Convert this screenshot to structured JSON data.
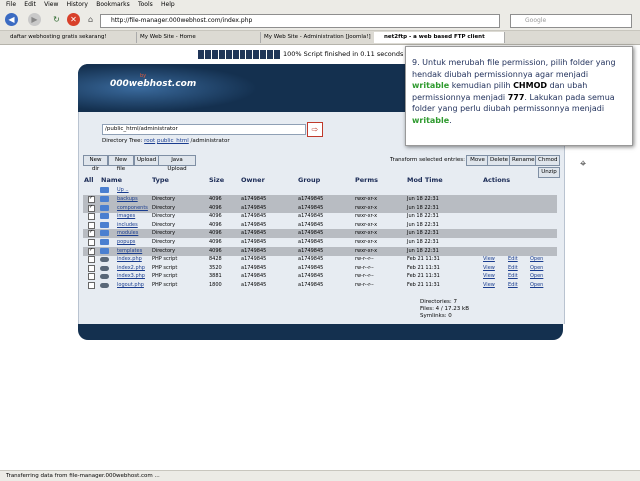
{
  "browser": {
    "menu": [
      "File",
      "Edit",
      "View",
      "History",
      "Bookmarks",
      "Tools",
      "Help"
    ],
    "url": "http://file-manager.000webhost.com/index.php",
    "search_placeholder": "Google",
    "tabs": [
      "daftar webhosting gratis sekarang!",
      "My Web Site - Home",
      "My Web Site - Administration [Joomla!]",
      "net2ftp - a web based FTP client"
    ],
    "status": "Transferring data from file-manager.000webhost.com ..."
  },
  "progress_text": "100% Script finished in 0.11 seconds",
  "logo": {
    "by": "by",
    "name": "000webhost.com"
  },
  "path_input": "/public_html/administrator",
  "tree": {
    "label": "Directory Tree:",
    "root": "root",
    "public_html": "public_html",
    "current": "/administrator"
  },
  "buttons": {
    "new_dir": "New dir",
    "new_file": "New file",
    "upload": "Upload",
    "java_upload": "Java Upload",
    "transform_label": "Transform selected entries:",
    "move": "Move",
    "delete": "Delete",
    "rename": "Rename",
    "chmod": "Chmod",
    "unzip": "Unzip"
  },
  "table": {
    "headers": [
      "All",
      "Name",
      "Type",
      "Size",
      "Owner",
      "Group",
      "Perms",
      "Mod Time",
      "Actions"
    ],
    "up": "Up ..",
    "rows": [
      {
        "name": "backups",
        "type": "Directory",
        "size": "4096",
        "owner": "a1749845",
        "group": "a1749845",
        "perms": "rwxr-xr-x",
        "mod": "Jun 18 22:31",
        "checked": true,
        "gray": true,
        "kind": "dir"
      },
      {
        "name": "components",
        "type": "Directory",
        "size": "4096",
        "owner": "a1749845",
        "group": "a1749845",
        "perms": "rwxr-xr-x",
        "mod": "Jun 18 22:31",
        "checked": true,
        "gray": true,
        "kind": "dir"
      },
      {
        "name": "images",
        "type": "Directory",
        "size": "4096",
        "owner": "a1749845",
        "group": "a1749845",
        "perms": "rwxr-xr-x",
        "mod": "Jun 18 22:31",
        "checked": false,
        "gray": false,
        "kind": "dir"
      },
      {
        "name": "includes",
        "type": "Directory",
        "size": "4096",
        "owner": "a1749845",
        "group": "a1749845",
        "perms": "rwxr-xr-x",
        "mod": "Jun 18 22:31",
        "checked": false,
        "gray": false,
        "kind": "dir"
      },
      {
        "name": "modules",
        "type": "Directory",
        "size": "4096",
        "owner": "a1749845",
        "group": "a1749845",
        "perms": "rwxr-xr-x",
        "mod": "Jun 18 22:31",
        "checked": true,
        "gray": true,
        "kind": "dir"
      },
      {
        "name": "popups",
        "type": "Directory",
        "size": "4096",
        "owner": "a1749845",
        "group": "a1749845",
        "perms": "rwxr-xr-x",
        "mod": "Jun 18 22:31",
        "checked": false,
        "gray": false,
        "kind": "dir"
      },
      {
        "name": "templates",
        "type": "Directory",
        "size": "4096",
        "owner": "a1749845",
        "group": "a1749845",
        "perms": "rwxr-xr-x",
        "mod": "Jun 18 22:31",
        "checked": true,
        "gray": true,
        "kind": "dir"
      },
      {
        "name": "index.php",
        "type": "PHP script",
        "size": "8428",
        "owner": "a1749845",
        "group": "a1749845",
        "perms": "rw-r--r--",
        "mod": "Feb 21 11:31",
        "checked": false,
        "gray": false,
        "kind": "php"
      },
      {
        "name": "index2.php",
        "type": "PHP script",
        "size": "3520",
        "owner": "a1749845",
        "group": "a1749845",
        "perms": "rw-r--r--",
        "mod": "Feb 21 11:31",
        "checked": false,
        "gray": false,
        "kind": "php"
      },
      {
        "name": "index3.php",
        "type": "PHP script",
        "size": "3881",
        "owner": "a1749845",
        "group": "a1749845",
        "perms": "rw-r--r--",
        "mod": "Feb 21 11:31",
        "checked": false,
        "gray": false,
        "kind": "php"
      },
      {
        "name": "logout.php",
        "type": "PHP script",
        "size": "1800",
        "owner": "a1749845",
        "group": "a1749845",
        "perms": "rw-r--r--",
        "mod": "Feb 21 11:31",
        "checked": false,
        "gray": false,
        "kind": "php"
      }
    ],
    "actions": [
      "View",
      "Edit",
      "Open"
    ]
  },
  "stats": {
    "directories": "Directories: 7",
    "files": "Files: 4 / 17.23 kB",
    "symlinks": "Symlinks: 0"
  },
  "callout": {
    "p1": "9. Untuk merubah file permission, pilih folder yang hendak diubah permissionnya agar menjadi ",
    "w1": "writable",
    "p2": " kemudian pilih ",
    "chmod": "CHMOD",
    "p3": " dan ubah permissionnya menjadi ",
    "num": "777",
    "p4": ". Lakukan pada semua folder yang perlu diubah permissonnya menjadi ",
    "w2": "writable",
    "p5": "."
  },
  "colors": {
    "header_bg": "#14304f",
    "content_bg": "#e7ecf2",
    "highlight_green": "#2e9a2e"
  }
}
